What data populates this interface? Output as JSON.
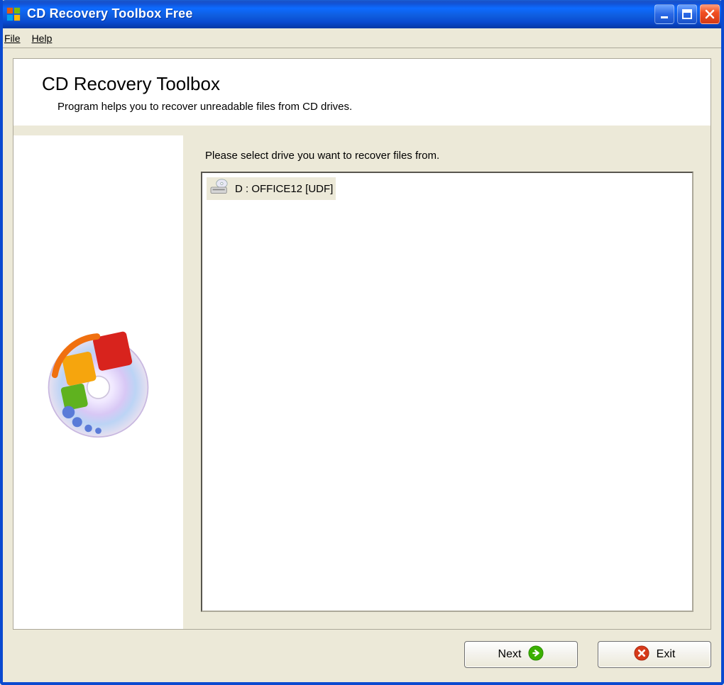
{
  "window": {
    "title": "CD Recovery Toolbox Free"
  },
  "menu": {
    "file": "File",
    "help": "Help"
  },
  "header": {
    "title": "CD Recovery Toolbox",
    "subtitle": "Program helps you to recover unreadable files from CD drives."
  },
  "main": {
    "instruction": "Please select drive you want to recover files from.",
    "drives": [
      {
        "label": "D : OFFICE12 [UDF]"
      }
    ]
  },
  "buttons": {
    "next": "Next",
    "exit": "Exit"
  }
}
